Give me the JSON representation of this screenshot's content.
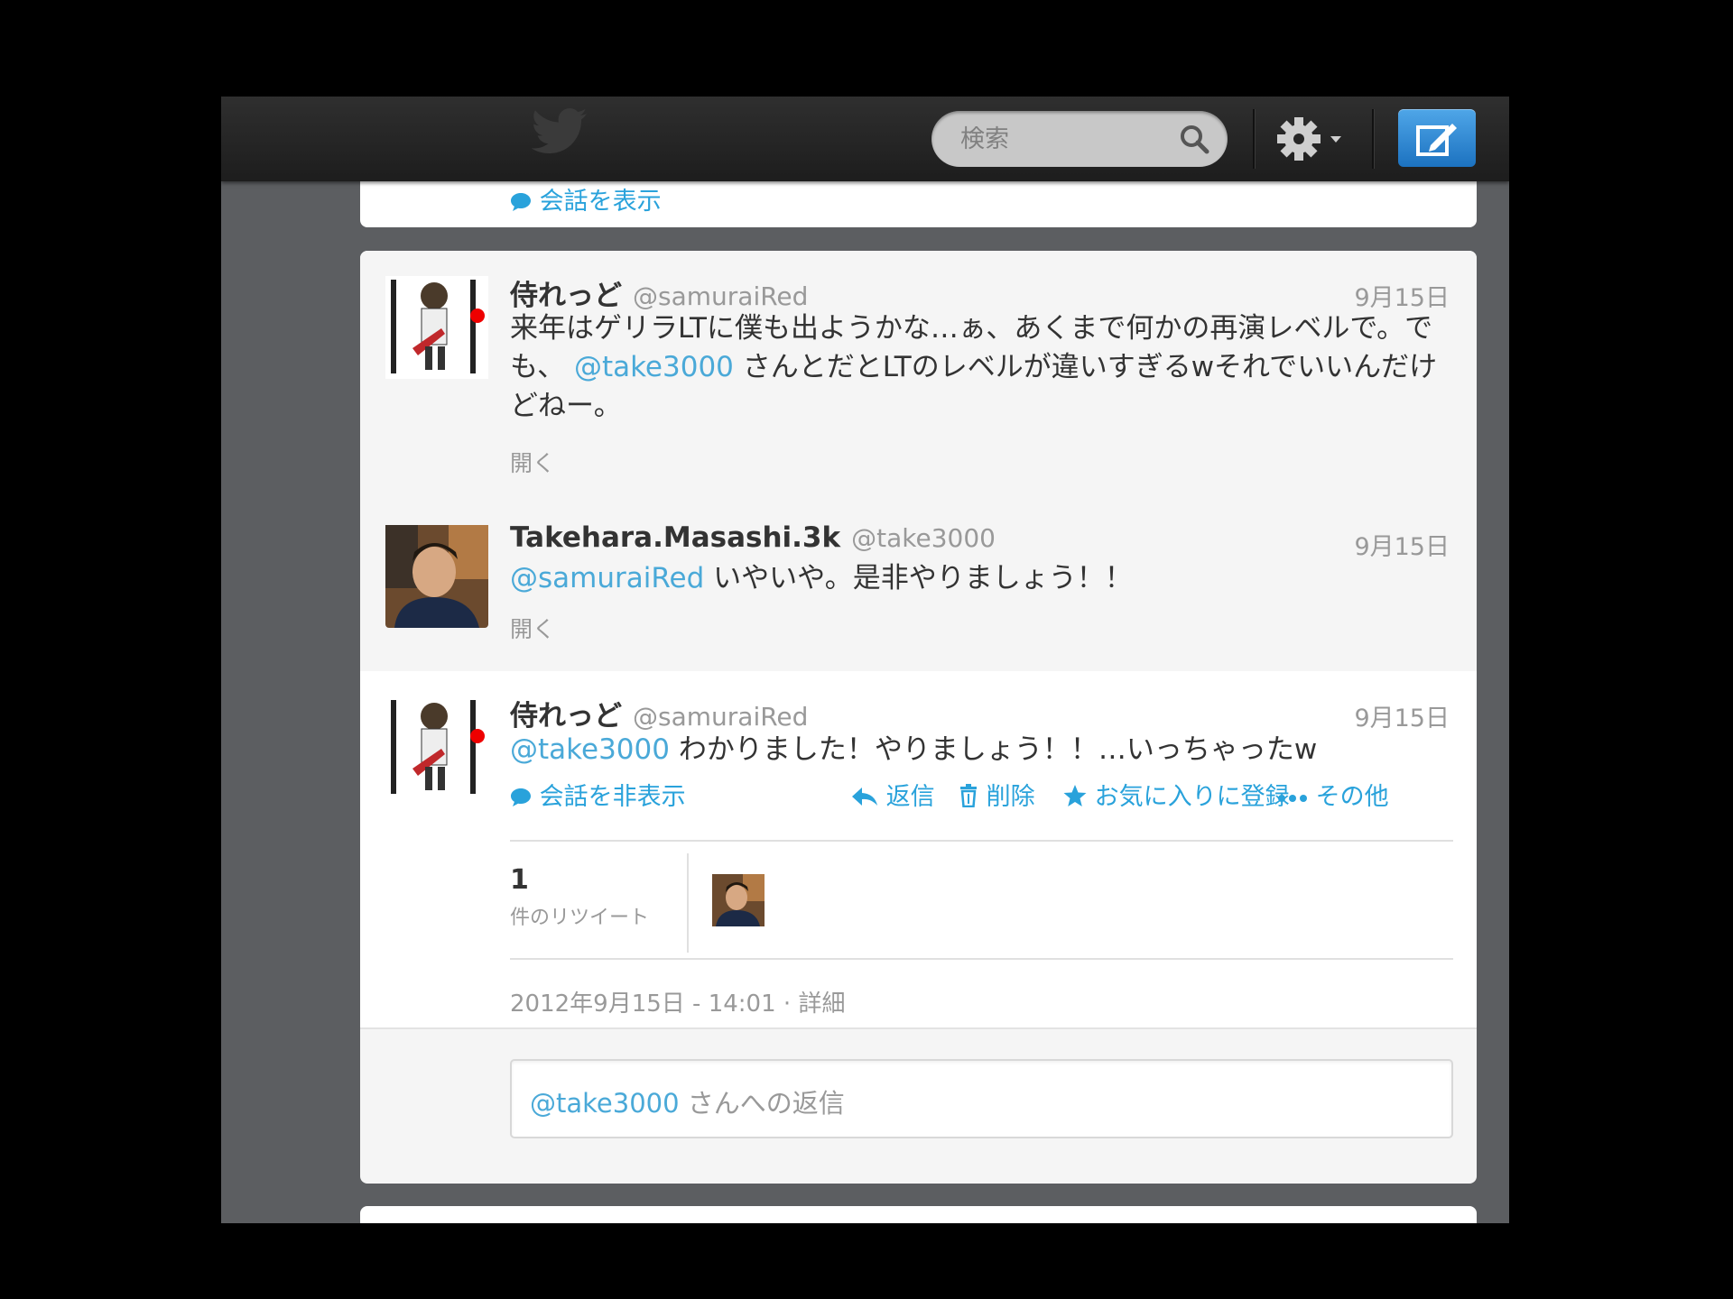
{
  "header": {
    "search_placeholder": "検索",
    "icons": [
      "twitter-bird-icon",
      "search-icon",
      "gear-icon",
      "compose-icon"
    ]
  },
  "prev_card": {
    "conversation_link": "会話を表示"
  },
  "tweets": [
    {
      "name": "侍れっど",
      "handle": "@samuraiRed",
      "date": "9月15日",
      "text_a": "来年はゲリラLTに僕も出ようかな…ぁ、あくまで何かの再演レベルで。でも、",
      "mention": "@take3000",
      "text_b": "さんとだとLTのレベルが違いすぎるwそれでいいんだけどねー。",
      "expand": "開く"
    },
    {
      "name": "Takehara.Masashi.3k",
      "handle": "@take3000",
      "date": "9月15日",
      "mention": "@samuraiRed",
      "text": "いやいや。是非やりましょう！！",
      "expand": "開く"
    },
    {
      "name": "侍れっど",
      "handle": "@samuraiRed",
      "date": "9月15日",
      "mention": "@take3000",
      "text": "わかりました！やりましょう！！…いっちゃったw",
      "actions": {
        "hide_conversation": "会話を非表示",
        "reply": "返信",
        "delete": "削除",
        "favorite": "お気に入りに登録",
        "more": "その他"
      },
      "retweet_count": "1",
      "retweet_label": "件のリツイート",
      "timestamp": "2012年9月15日 - 14:01",
      "details_link": "詳細"
    }
  ],
  "reply_box": {
    "mention": "@take3000",
    "placeholder": "さんへの返信"
  },
  "colors": {
    "link": "#29a2db",
    "topbar": "#252525",
    "compose": "#2b87d1"
  }
}
